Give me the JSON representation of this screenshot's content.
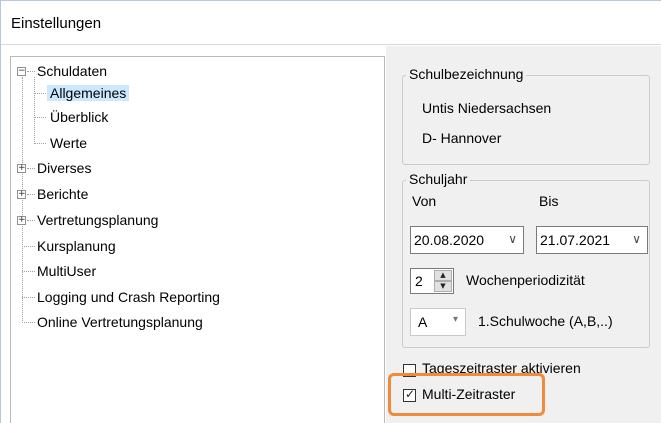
{
  "window": {
    "title": "Einstellungen"
  },
  "tree": {
    "root": "Schuldaten",
    "children": [
      "Allgemeines",
      "Überblick",
      "Werte"
    ],
    "items": [
      "Diverses",
      "Berichte",
      "Vertretungsplanung",
      "Kursplanung",
      "MultiUser",
      "Logging und Crash Reporting",
      "Online Vertretungsplanung"
    ],
    "selected": "Allgemeines"
  },
  "school": {
    "group_label": "Schulbezeichnung",
    "name": "Untis Niedersachsen",
    "location": "D- Hannover"
  },
  "schoolyear": {
    "group_label": "Schuljahr",
    "from_label": "Von",
    "to_label": "Bis",
    "from_value": "20.08.2020",
    "to_value": "21.07.2021",
    "period_value": "2",
    "period_label": "Wochenperiodizität",
    "week_value": "A",
    "week_label": "1.Schulwoche (A,B,..)"
  },
  "options": {
    "tageszeitraster_label": "Tageszeitraster aktivieren",
    "tageszeitraster_checked": false,
    "multizeitraster_label": "Multi-Zeitraster",
    "multizeitraster_checked": true
  },
  "colors": {
    "highlight": "#f08a3c",
    "selection": "#cce8ff",
    "panel": "#f0f0f0"
  }
}
